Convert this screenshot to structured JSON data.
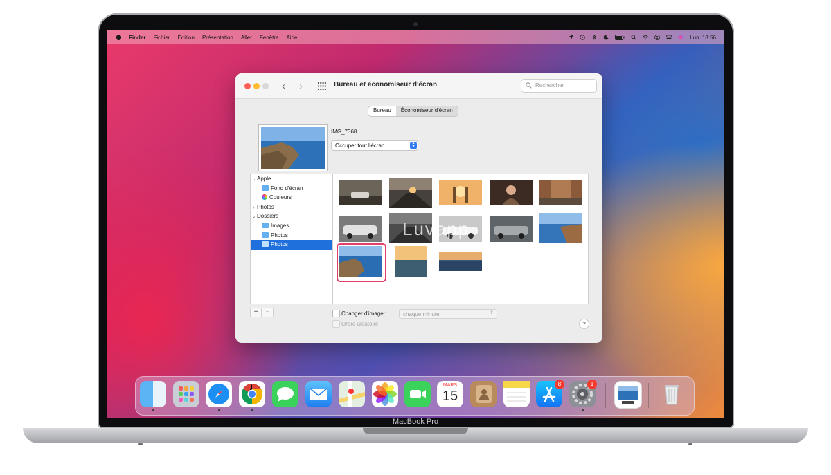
{
  "menubar": {
    "app": "Finder",
    "items": [
      "Fichier",
      "Édition",
      "Présentation",
      "Aller",
      "Fenêtre",
      "Aide"
    ],
    "clock": "Lun. 18:56"
  },
  "window": {
    "title": "Bureau et économiseur d'écran",
    "search_placeholder": "Rechercher",
    "tabs": [
      {
        "label": "Bureau",
        "selected": true
      },
      {
        "label": "Économiseur d'écran",
        "selected": false
      }
    ],
    "image_name": "IMG_7368",
    "fill_option": "Occuper tout l'écran",
    "sidebar": [
      {
        "label": "Apple",
        "type": "group",
        "expanded": true
      },
      {
        "label": "Fond d'écran",
        "type": "folder"
      },
      {
        "label": "Couleurs",
        "type": "colors"
      },
      {
        "label": "Photos",
        "type": "group",
        "expanded": false
      },
      {
        "label": "Dossiers",
        "type": "group",
        "expanded": true
      },
      {
        "label": "Images",
        "type": "folder"
      },
      {
        "label": "Photos",
        "type": "folder"
      },
      {
        "label": "Photos",
        "type": "folder",
        "selected": true
      }
    ],
    "gallery_watermark": "Luvapp",
    "change_picture_label": "Changer d'image :",
    "change_interval": "chaque minute",
    "random_order_label": "Ordre aléatoire",
    "help_label": "?",
    "add_label": "+",
    "remove_label": "−"
  },
  "dock": {
    "calendar_month": "MARS",
    "calendar_day": "15",
    "appstore_badge": "8",
    "settings_badge": "1"
  },
  "device": {
    "model": "MacBook Pro"
  },
  "colors": {
    "selection": "#1f6fdc",
    "highlight_frame": "#e0406a",
    "badge": "#f53b30"
  }
}
